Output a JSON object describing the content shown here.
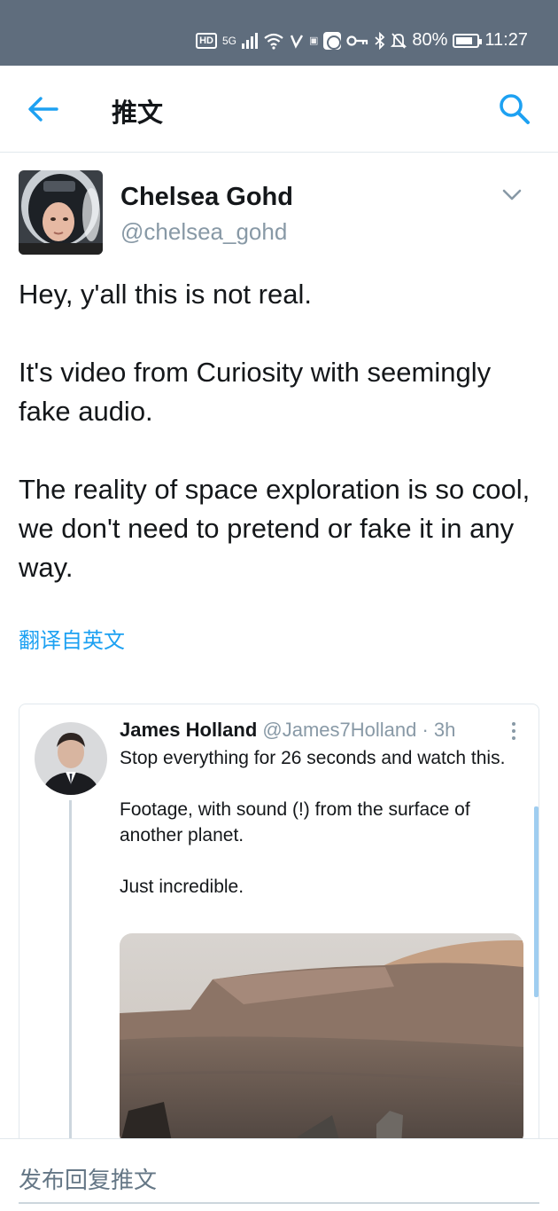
{
  "status_bar": {
    "network_badge": "HD",
    "signal_label": "5G",
    "battery": "80%",
    "time": "11:27",
    "background": "#5f6d7d"
  },
  "header": {
    "title": "推文",
    "accent_color": "#1da1f2",
    "back_icon": "arrow-left-icon",
    "search_icon": "search-icon"
  },
  "tweet": {
    "author_name": "Chelsea Gohd",
    "author_handle": "@chelsea_gohd",
    "paragraphs": [
      "Hey, y'all this is not real.",
      "It's video from Curiosity with seemingly fake audio.",
      "The reality of space exploration is so cool, we don't need to pretend or fake it in any way."
    ],
    "translate_label": "翻译自英文"
  },
  "quoted_tweet": {
    "author_name": "James Holland",
    "meta": "@James7Holland · 3h",
    "paragraphs": [
      "Stop everything for 26 seconds and watch this.",
      "Footage, with sound (!) from the surface of another planet.",
      "Just incredible."
    ]
  },
  "reply": {
    "placeholder": "发布回复推文"
  }
}
